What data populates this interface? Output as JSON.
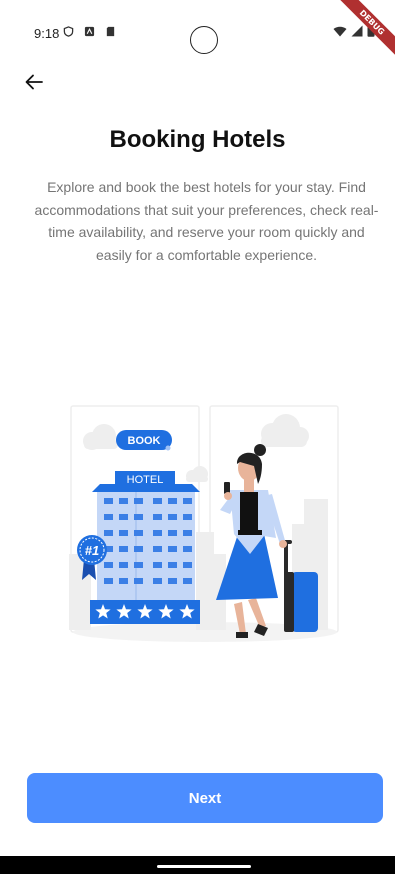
{
  "status_bar": {
    "time": "9:18",
    "debug_label": "DEBUG"
  },
  "header": {
    "back_icon": "arrow-left-icon"
  },
  "main": {
    "title": "Booking Hotels",
    "description": "Explore and book the best hotels for your stay. Find accommodations that suit your preferences, check real-time availability, and reserve your room quickly and easily for a comfortable experience."
  },
  "illustration": {
    "book_label": "BOOK",
    "hotel_label": "HOTEL",
    "rank_label": "#1",
    "stars": 5
  },
  "actions": {
    "next_label": "Next"
  },
  "colors": {
    "accent": "#4c8dff",
    "illustration_blue": "#1f6fe0",
    "title": "#111111",
    "body_text": "#757575"
  }
}
